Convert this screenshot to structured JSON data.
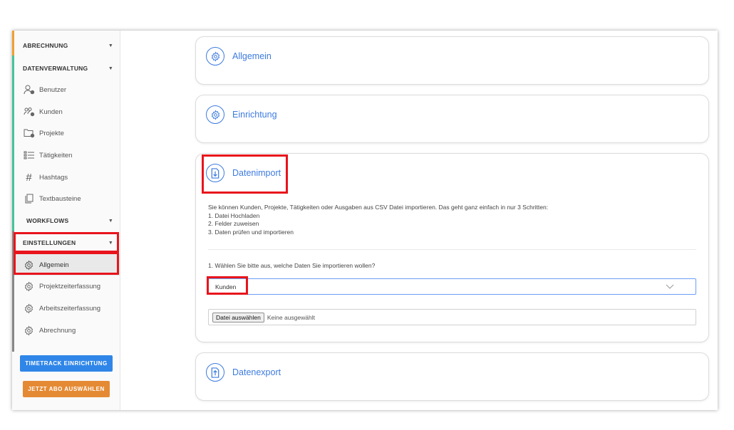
{
  "sidebar": {
    "sections": [
      {
        "label": "ABRECHNUNG",
        "accent": "#f0a030"
      },
      {
        "label": "DATENVERWALTUNG",
        "accent": "#45c49b"
      },
      {
        "label": "WORKFLOWS",
        "accent": "#3d7be0"
      },
      {
        "label": "EINSTELLUNGEN",
        "accent": "#888888"
      }
    ],
    "datenverwaltung_items": [
      {
        "label": "Benutzer",
        "icon": "user-settings-icon"
      },
      {
        "label": "Kunden",
        "icon": "customers-icon"
      },
      {
        "label": "Projekte",
        "icon": "project-folder-icon"
      },
      {
        "label": "Tätigkeiten",
        "icon": "list-icon"
      },
      {
        "label": "Hashtags",
        "icon": "hashtag-icon"
      },
      {
        "label": "Textbausteine",
        "icon": "text-blocks-icon"
      }
    ],
    "einstellungen_items": [
      {
        "label": "Allgemein",
        "icon": "gear-icon"
      },
      {
        "label": "Projektzeiterfassung",
        "icon": "gear-icon"
      },
      {
        "label": "Arbeitszeiterfassung",
        "icon": "gear-icon"
      },
      {
        "label": "Abrechnung",
        "icon": "gear-icon"
      }
    ],
    "buttons": {
      "setup": "TIMETRACK EINRICHTUNG",
      "subscription": "JETZT ABO AUSWÄHLEN"
    }
  },
  "colors": {
    "accent_blue": "#3d7be0",
    "button_blue": "#2f86e8",
    "button_orange": "#e58a34",
    "highlight_red": "#e8141c"
  },
  "cards": {
    "allgemein": {
      "title": "Allgemein",
      "icon": "gear-icon"
    },
    "einrichtung": {
      "title": "Einrichtung",
      "icon": "gear-icon"
    },
    "datenimport": {
      "title": "Datenimport",
      "icon": "file-import-icon",
      "description": [
        "Sie können Kunden, Projekte, Tätigkeiten oder Ausgaben aus CSV Datei importieren. Das geht ganz einfach in nur 3 Schritten:",
        "1. Datei Hochladen",
        "2. Felder zuweisen",
        "3. Daten prüfen und importieren"
      ],
      "question": "1. Wählen Sie bitte aus, welche Daten Sie importieren wollen?",
      "select_value": "Kunden",
      "file_button": "Datei auswählen",
      "file_status": "Keine ausgewählt"
    },
    "datenexport": {
      "title": "Datenexport",
      "icon": "file-export-icon"
    }
  }
}
